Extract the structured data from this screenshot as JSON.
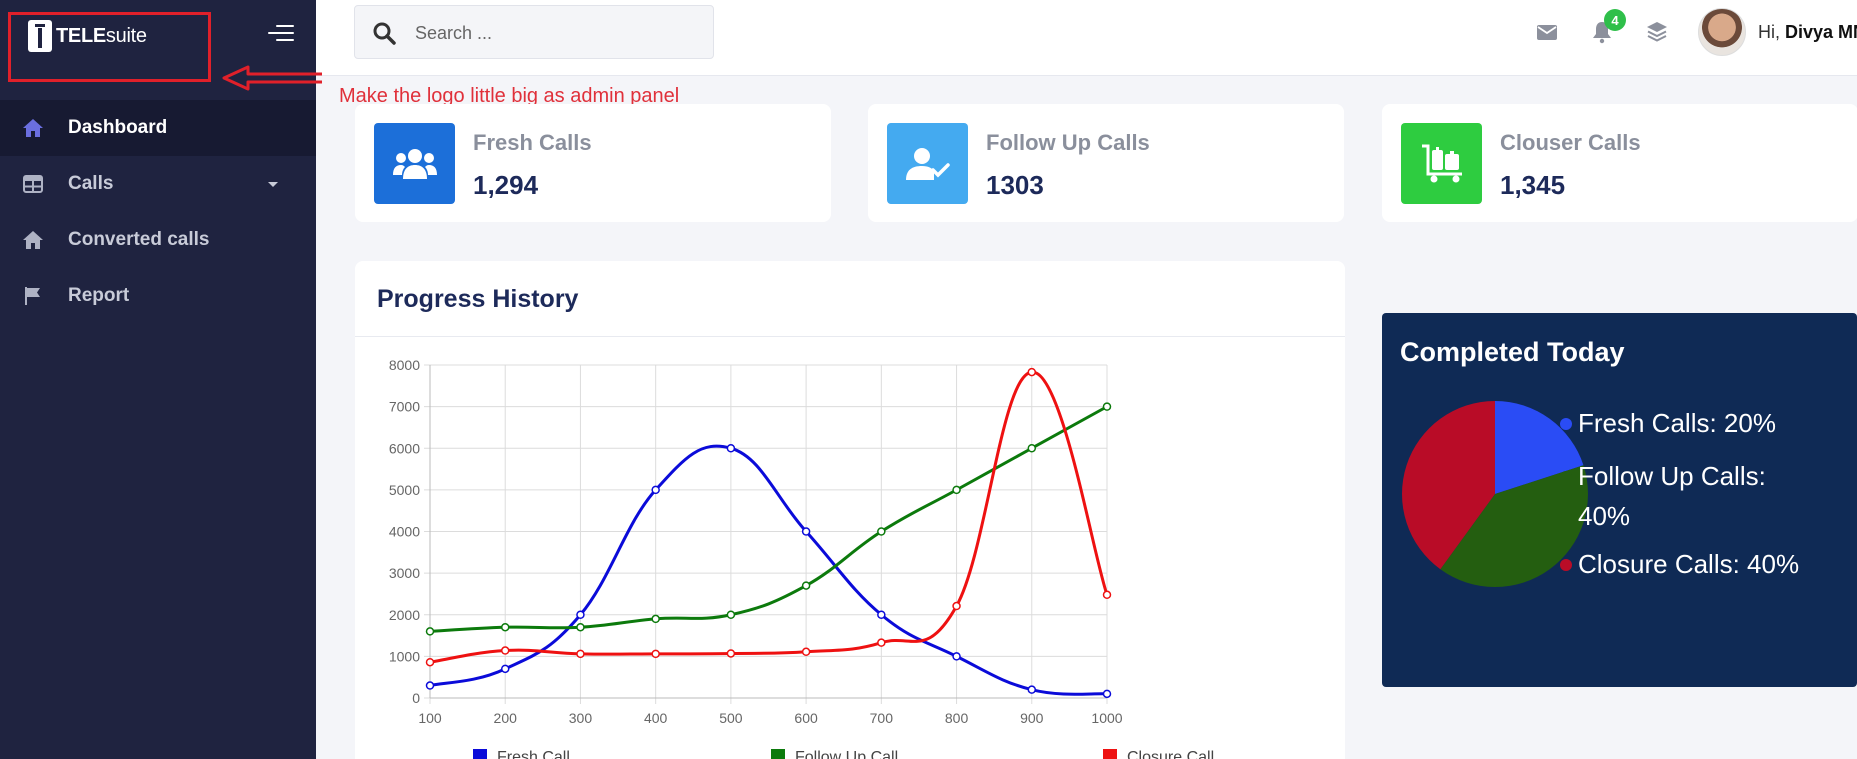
{
  "app": {
    "logo_bold": "TELE",
    "logo_rest": "suite"
  },
  "annotation": "Make the logo little big as admin panel",
  "sidebar": {
    "items": [
      {
        "label": "Dashboard",
        "icon": "home-icon",
        "active": true
      },
      {
        "label": "Calls",
        "icon": "table-icon",
        "has_caret": true
      },
      {
        "label": "Converted calls",
        "icon": "home-icon"
      },
      {
        "label": "Report",
        "icon": "flag-icon"
      }
    ]
  },
  "topbar": {
    "search_placeholder": "Search ...",
    "notification_count": "4",
    "greeting": "Hi,",
    "user_name": "Divya MN"
  },
  "cards": [
    {
      "title": "Fresh Calls",
      "value": "1,294",
      "color": "#1c6fd9",
      "icon": "users-icon"
    },
    {
      "title": "Follow Up Calls",
      "value": "1303",
      "color": "#44aaf0",
      "icon": "user-check-icon"
    },
    {
      "title": "Clouser Calls",
      "value": "1,345",
      "color": "#2ecc40",
      "icon": "luggage-cart-icon"
    }
  ],
  "progress": {
    "title": "Progress History"
  },
  "chart_data": {
    "type": "line",
    "x": [
      100,
      200,
      300,
      400,
      500,
      600,
      700,
      800,
      900,
      1000
    ],
    "ylim": [
      0,
      8000
    ],
    "yticks": [
      0,
      1000,
      2000,
      3000,
      4000,
      5000,
      6000,
      7000,
      8000
    ],
    "grid": true,
    "legend_position": "bottom",
    "series": [
      {
        "name": "Fresh Call",
        "color": "#0b0bd9",
        "values": [
          300,
          700,
          2000,
          5000,
          6000,
          4000,
          2000,
          1000,
          200,
          100
        ]
      },
      {
        "name": "Follow Up Call",
        "color": "#0c7a0c",
        "values": [
          1600,
          1700,
          1700,
          1900,
          2000,
          2700,
          4000,
          5000,
          6000,
          7000
        ]
      },
      {
        "name": "Closure Call",
        "color": "#ee1111",
        "values": [
          860,
          1140,
          1060,
          1060,
          1070,
          1110,
          1330,
          2210,
          7830,
          2480
        ]
      }
    ]
  },
  "completed_today": {
    "title": "Completed Today",
    "chart_data": {
      "type": "pie",
      "slices": [
        {
          "label": "Fresh Calls: 20%",
          "value": 20,
          "color": "#2a4cf5"
        },
        {
          "label": "Follow Up Calls: 40%",
          "value": 40,
          "color": "#245e10"
        },
        {
          "label": "Closure Calls: 40%",
          "value": 40,
          "color": "#b90c27"
        }
      ]
    }
  }
}
